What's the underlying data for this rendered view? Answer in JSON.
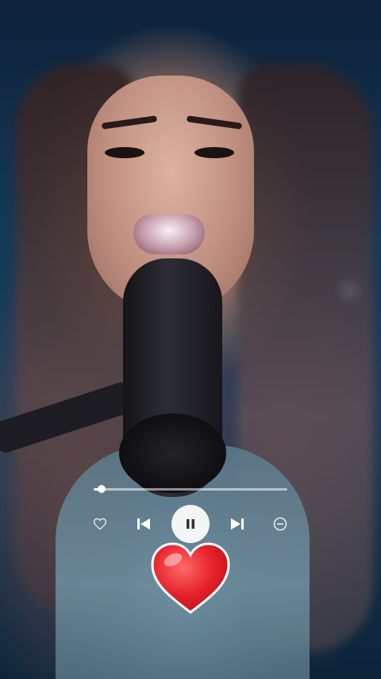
{
  "player": {
    "progress_fraction": 0.04,
    "state": "playing"
  },
  "icons": {
    "like": "heart-outline-icon",
    "previous": "skip-previous-icon",
    "pause": "pause-icon",
    "next": "skip-next-icon",
    "remove": "minus-circle-icon",
    "reaction": "red-heart-icon"
  },
  "colors": {
    "heart": "#e5202a",
    "controls": "#ffffff"
  }
}
